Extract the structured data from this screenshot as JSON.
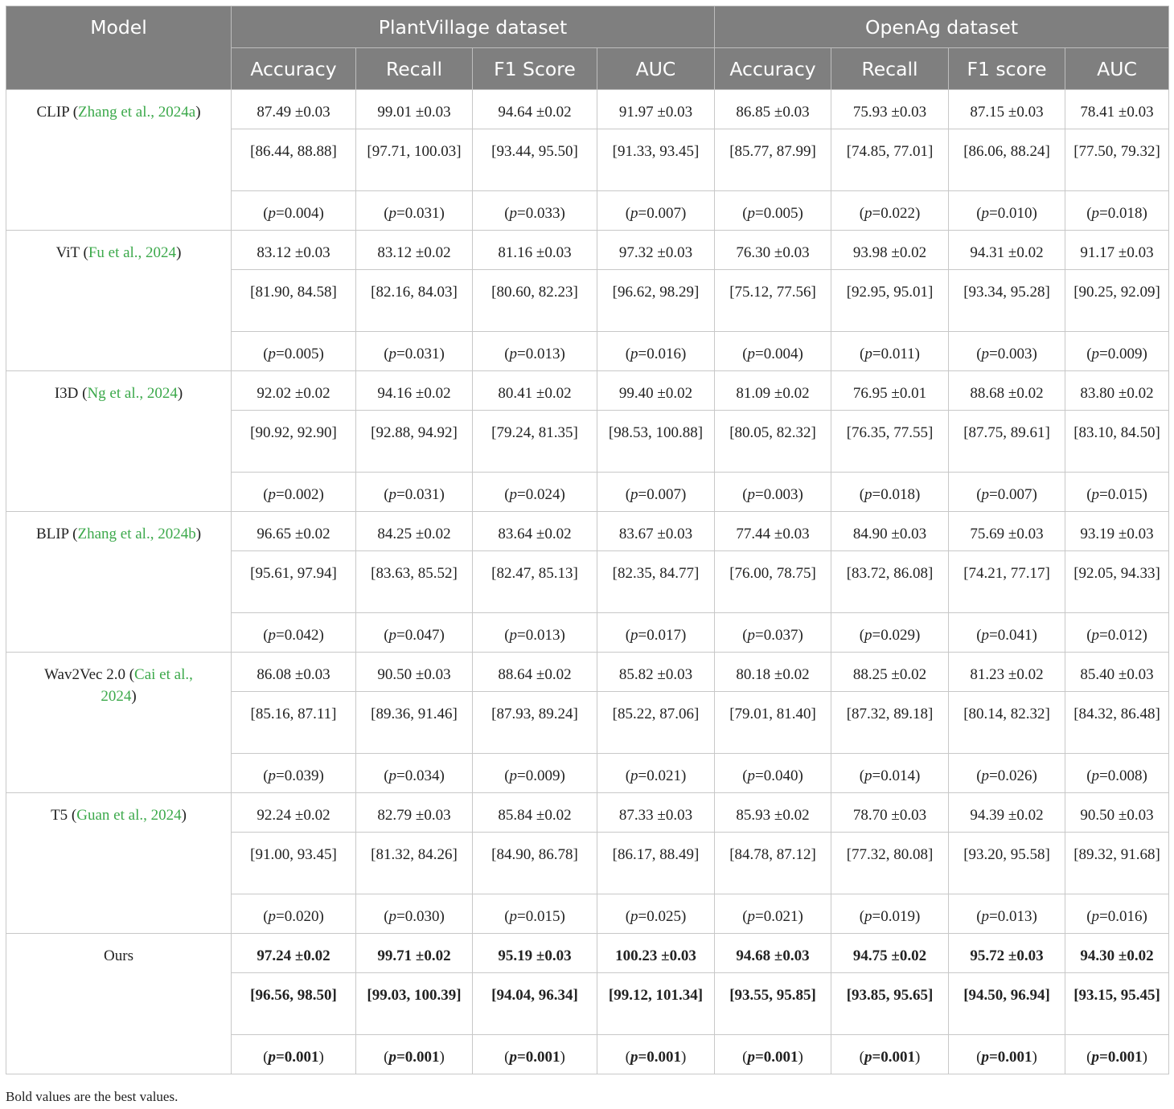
{
  "header": {
    "model": "Model",
    "datasets": [
      "PlantVillage dataset",
      "OpenAg dataset"
    ],
    "metrics": [
      "Accuracy",
      "Recall",
      "F1 Score",
      "AUC",
      "Accuracy",
      "Recall",
      "F1 score",
      "AUC"
    ]
  },
  "rows": [
    {
      "name": "CLIP (",
      "cite": "Zhang et al., 2024a",
      "suffix": ")",
      "bold": false,
      "mean": [
        "87.49 ±0.03",
        "99.01 ±0.03",
        "94.64 ±0.02",
        "91.97 ±0.03",
        "86.85 ±0.03",
        "75.93 ±0.03",
        "87.15 ±0.03",
        "78.41 ±0.03"
      ],
      "ci": [
        "[86.44, 88.88]",
        "[97.71, 100.03]",
        "[93.44, 95.50]",
        "[91.33, 93.45]",
        "[85.77, 87.99]",
        "[74.85, 77.01]",
        "[86.06, 88.24]",
        "[77.50, 79.32]"
      ],
      "p": [
        "0.004",
        "0.031",
        "0.033",
        "0.007",
        "0.005",
        "0.022",
        "0.010",
        "0.018"
      ]
    },
    {
      "name": "ViT (",
      "cite": "Fu et al., 2024",
      "suffix": ")",
      "bold": false,
      "mean": [
        "83.12 ±0.03",
        "83.12 ±0.02",
        "81.16 ±0.03",
        "97.32 ±0.03",
        "76.30 ±0.03",
        "93.98 ±0.02",
        "94.31 ±0.02",
        "91.17 ±0.03"
      ],
      "ci": [
        "[81.90, 84.58]",
        "[82.16, 84.03]",
        "[80.60, 82.23]",
        "[96.62, 98.29]",
        "[75.12, 77.56]",
        "[92.95, 95.01]",
        "[93.34, 95.28]",
        "[90.25, 92.09]"
      ],
      "p": [
        "0.005",
        "0.031",
        "0.013",
        "0.016",
        "0.004",
        "0.011",
        "0.003",
        "0.009"
      ]
    },
    {
      "name": "I3D (",
      "cite": "Ng et al., 2024",
      "suffix": ")",
      "bold": false,
      "mean": [
        "92.02 ±0.02",
        "94.16 ±0.02",
        "80.41 ±0.02",
        "99.40 ±0.02",
        "81.09 ±0.02",
        "76.95 ±0.01",
        "88.68 ±0.02",
        "83.80 ±0.02"
      ],
      "ci": [
        "[90.92, 92.90]",
        "[92.88, 94.92]",
        "[79.24, 81.35]",
        "[98.53, 100.88]",
        "[80.05, 82.32]",
        "[76.35, 77.55]",
        "[87.75, 89.61]",
        "[83.10, 84.50]"
      ],
      "p": [
        "0.002",
        "0.031",
        "0.024",
        "0.007",
        "0.003",
        "0.018",
        "0.007",
        "0.015"
      ]
    },
    {
      "name": "BLIP (",
      "cite": "Zhang et al., 2024b",
      "suffix": ")",
      "bold": false,
      "mean": [
        "96.65 ±0.02",
        "84.25 ±0.02",
        "83.64 ±0.02",
        "83.67 ±0.03",
        "77.44 ±0.03",
        "84.90 ±0.03",
        "75.69 ±0.03",
        "93.19 ±0.03"
      ],
      "ci": [
        "[95.61, 97.94]",
        "[83.63, 85.52]",
        "[82.47, 85.13]",
        "[82.35, 84.77]",
        "[76.00, 78.75]",
        "[83.72, 86.08]",
        "[74.21, 77.17]",
        "[92.05, 94.33]"
      ],
      "p": [
        "0.042",
        "0.047",
        "0.013",
        "0.017",
        "0.037",
        "0.029",
        "0.041",
        "0.012"
      ]
    },
    {
      "name": "Wav2Vec 2.0 (",
      "cite": "Cai et al., 2024",
      "suffix": ")",
      "bold": false,
      "mean": [
        "86.08 ±0.03",
        "90.50 ±0.03",
        "88.64 ±0.02",
        "85.82 ±0.03",
        "80.18 ±0.02",
        "88.25 ±0.02",
        "81.23 ±0.02",
        "85.40 ±0.03"
      ],
      "ci": [
        "[85.16, 87.11]",
        "[89.36, 91.46]",
        "[87.93, 89.24]",
        "[85.22, 87.06]",
        "[79.01, 81.40]",
        "[87.32, 89.18]",
        "[80.14, 82.32]",
        "[84.32, 86.48]"
      ],
      "p": [
        "0.039",
        "0.034",
        "0.009",
        "0.021",
        "0.040",
        "0.014",
        "0.026",
        "0.008"
      ]
    },
    {
      "name": "T5 (",
      "cite": "Guan et al., 2024",
      "suffix": ")",
      "bold": false,
      "mean": [
        "92.24 ±0.02",
        "82.79 ±0.03",
        "85.84 ±0.02",
        "87.33 ±0.03",
        "85.93 ±0.02",
        "78.70 ±0.03",
        "94.39 ±0.02",
        "90.50 ±0.03"
      ],
      "ci": [
        "[91.00, 93.45]",
        "[81.32, 84.26]",
        "[84.90, 86.78]",
        "[86.17, 88.49]",
        "[84.78, 87.12]",
        "[77.32, 80.08]",
        "[93.20, 95.58]",
        "[89.32, 91.68]"
      ],
      "p": [
        "0.020",
        "0.030",
        "0.015",
        "0.025",
        "0.021",
        "0.019",
        "0.013",
        "0.016"
      ]
    },
    {
      "name": "Ours",
      "cite": "",
      "suffix": "",
      "bold": true,
      "mean": [
        "97.24 ±0.02",
        "99.71 ±0.02",
        "95.19 ±0.03",
        "100.23 ±0.03",
        "94.68 ±0.03",
        "94.75 ±0.02",
        "95.72 ±0.03",
        "94.30 ±0.02"
      ],
      "ci": [
        "[96.56, 98.50]",
        "[99.03, 100.39]",
        "[94.04, 96.34]",
        "[99.12, 101.34]",
        "[93.55, 95.85]",
        "[93.85, 95.65]",
        "[94.50, 96.94]",
        "[93.15, 95.45]"
      ],
      "p": [
        "0.001",
        "0.001",
        "0.001",
        "0.001",
        "0.001",
        "0.001",
        "0.001",
        "0.001"
      ]
    }
  ],
  "p_prefix": "(",
  "p_symbol": "p",
  "p_eq": "=",
  "p_suffix": ")",
  "footnote": "Bold values are the best values.",
  "colors": {
    "header_bg": "#7f7f7f",
    "header_text": "#ffffff",
    "citation": "#3ca94b",
    "border": "#c8c8c8"
  }
}
